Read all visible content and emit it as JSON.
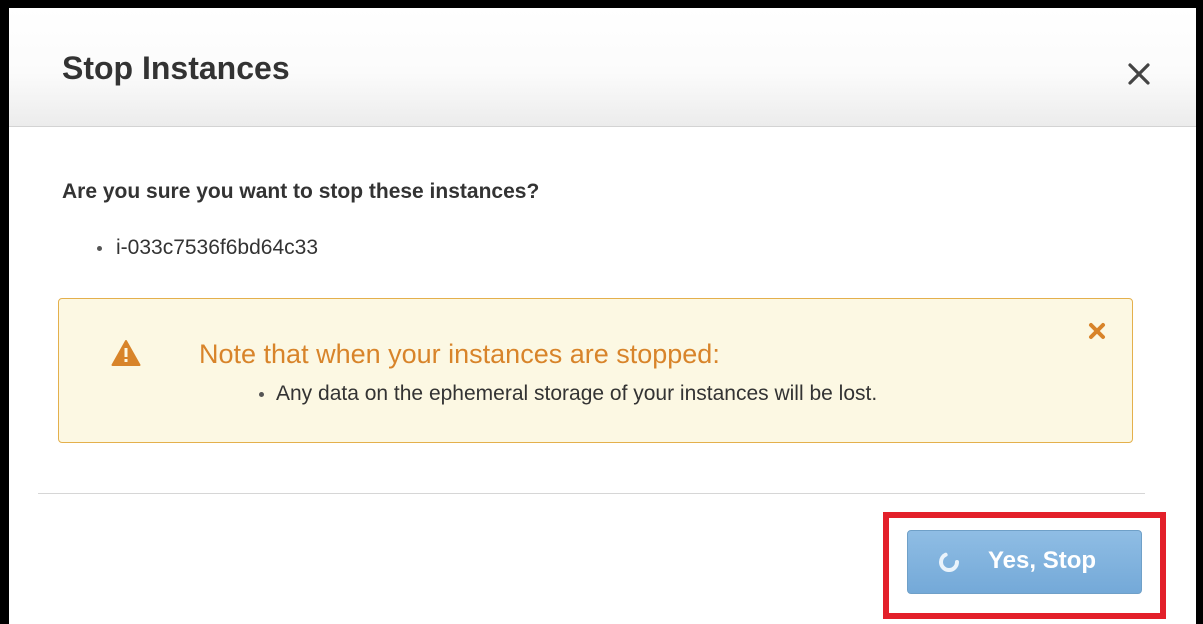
{
  "dialog": {
    "title": "Stop Instances",
    "close_icon": "close-icon",
    "question": "Are you sure you want to stop these instances?",
    "instances": [
      "i-033c7536f6bd64c33"
    ],
    "alert": {
      "icon": "warning-icon",
      "dismiss_icon": "dismiss-icon",
      "title": "Note that when your instances are stopped:",
      "items": [
        "Any data on the ephemeral storage of your instances will be lost."
      ]
    },
    "confirm_button": {
      "label": "Yes, Stop",
      "icon": "spinner-icon",
      "state": "loading"
    }
  },
  "colors": {
    "alert_background": "#fcf8e3",
    "alert_border": "#e4b04c",
    "alert_accent": "#d8842a",
    "button_blue": "#7fb2dd",
    "highlight_red": "#e3202a"
  }
}
